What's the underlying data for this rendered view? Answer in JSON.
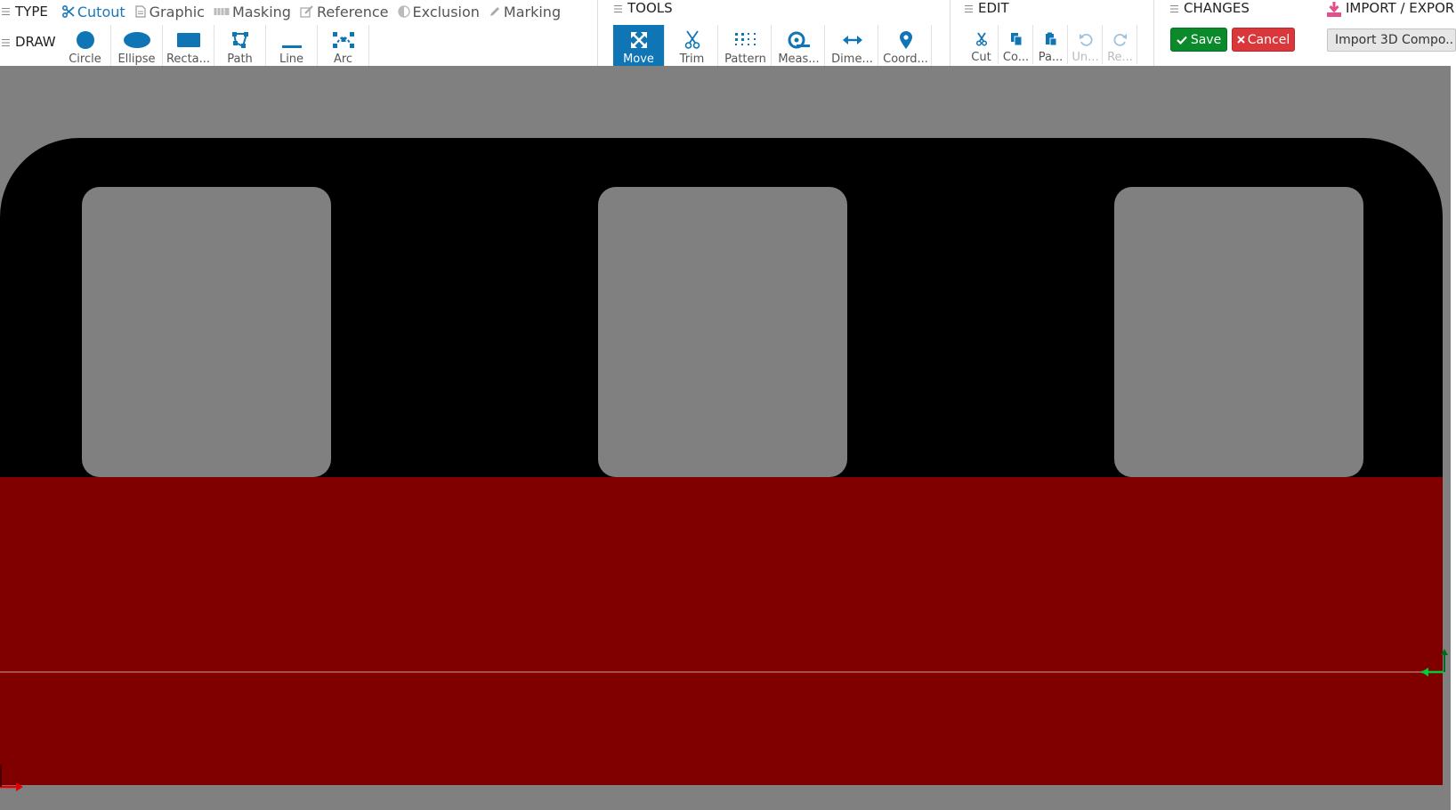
{
  "type_row": {
    "label": "TYPE",
    "options": [
      {
        "label": "Cutout",
        "icon": "scissors-icon",
        "active": true
      },
      {
        "label": "Graphic",
        "icon": "file-icon",
        "active": false
      },
      {
        "label": "Masking",
        "icon": "masking-tape-icon",
        "active": false
      },
      {
        "label": "Reference",
        "icon": "edit-square-icon",
        "active": false
      },
      {
        "label": "Exclusion",
        "icon": "half-circle-icon",
        "active": false
      },
      {
        "label": "Marking",
        "icon": "pencil-icon",
        "active": false
      }
    ]
  },
  "draw_row": {
    "label": "DRAW",
    "tools": [
      {
        "label": "Circle",
        "icon": "circle-icon"
      },
      {
        "label": "Ellipse",
        "icon": "ellipse-icon"
      },
      {
        "label": "Recta...",
        "icon": "rectangle-icon"
      },
      {
        "label": "Path",
        "icon": "path-icon"
      },
      {
        "label": "Line",
        "icon": "line-icon"
      },
      {
        "label": "Arc",
        "icon": "arc-icon"
      }
    ]
  },
  "tools": {
    "title": "TOOLS",
    "items": [
      {
        "label": "Move",
        "icon": "move-arrows-icon",
        "active": true
      },
      {
        "label": "Trim",
        "icon": "scissors-icon",
        "active": false
      },
      {
        "label": "Pattern",
        "icon": "grid-dots-icon",
        "active": false
      },
      {
        "label": "Meas...",
        "icon": "tape-measure-icon",
        "active": false
      },
      {
        "label": "Dime...",
        "icon": "double-arrow-icon",
        "active": false
      },
      {
        "label": "Coord...",
        "icon": "map-pin-icon",
        "active": false
      }
    ]
  },
  "edit": {
    "title": "EDIT",
    "items": [
      {
        "label": "Cut",
        "icon": "scissors-icon",
        "disabled": false
      },
      {
        "label": "Co...",
        "icon": "copy-icon",
        "disabled": false
      },
      {
        "label": "Pa...",
        "icon": "paste-icon",
        "disabled": false
      },
      {
        "label": "Un...",
        "icon": "undo-icon",
        "disabled": true
      },
      {
        "label": "Re...",
        "icon": "redo-icon",
        "disabled": true
      }
    ]
  },
  "changes": {
    "title": "CHANGES",
    "save_label": "Save",
    "cancel_label": "Cancel"
  },
  "import_export": {
    "title": "IMPORT / EXPOR",
    "select_value": "Import 3D Compo.."
  },
  "colors": {
    "accent": "#0f75b5",
    "canvas_bg": "#808080",
    "part_top": "#000000",
    "part_bottom": "#800000",
    "save": "#0a8a2a",
    "cancel": "#d9373a"
  }
}
